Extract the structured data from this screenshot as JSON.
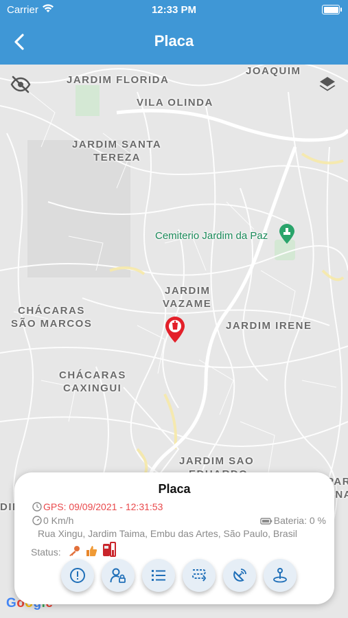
{
  "status_bar": {
    "carrier": "Carrier",
    "time": "12:33 PM"
  },
  "header": {
    "title": "Placa"
  },
  "map": {
    "labels": {
      "joaquim": "JOAQUIM",
      "jardim_florida": "JARDIM FLORIDA",
      "vila_olinda": "VILA OLINDA",
      "jardim_santa_tereza_1": "JARDIM SANTA",
      "jardim_santa_tereza_2": "TEREZA",
      "cemiterio": "Cemiterio Jardim da Paz",
      "jardim_vazame_1": "JARDIM",
      "jardim_vazame_2": "VAZAME",
      "chacaras_sao_marcos_1": "CHÁCARAS",
      "chacaras_sao_marcos_2": "SÃO MARCOS",
      "jardim_irene": "JARDIM IRENE",
      "chacaras_caxingui_1": "CHÁCARAS",
      "chacaras_caxingui_2": "CAXINGUI",
      "jardim_sao_eduardo_1": "JARDIM SAO",
      "jardim_sao_eduardo_2": "EDUARDO",
      "edge_left": "DIM",
      "edge_right_1": "PARC",
      "edge_right_2": "RNA"
    },
    "attribution": "Google"
  },
  "info_card": {
    "title": "Placa",
    "gps": "GPS: 09/09/2021 - 12:31:53",
    "speed": "0 Km/h",
    "battery": "Bateria: 0 %",
    "address": "Rua Xingu, Jardim Taima, Embu das Artes, São Paulo, Brasil",
    "status_label": "Status:"
  },
  "colors": {
    "brand": "#3f97d6",
    "gps_text": "#e9484b",
    "marker": "#e3202a",
    "action_icon": "#1f6fb8"
  },
  "icons": [
    "back-chevron-icon",
    "visibility-off-icon",
    "layers-icon",
    "clock-icon",
    "speedometer-icon",
    "battery-icon",
    "ignition-key-icon",
    "thumb-icon",
    "fuel-icon",
    "alert-icon",
    "user-lock-icon",
    "list-icon",
    "route-icon",
    "satellite-icon",
    "location-person-icon"
  ]
}
